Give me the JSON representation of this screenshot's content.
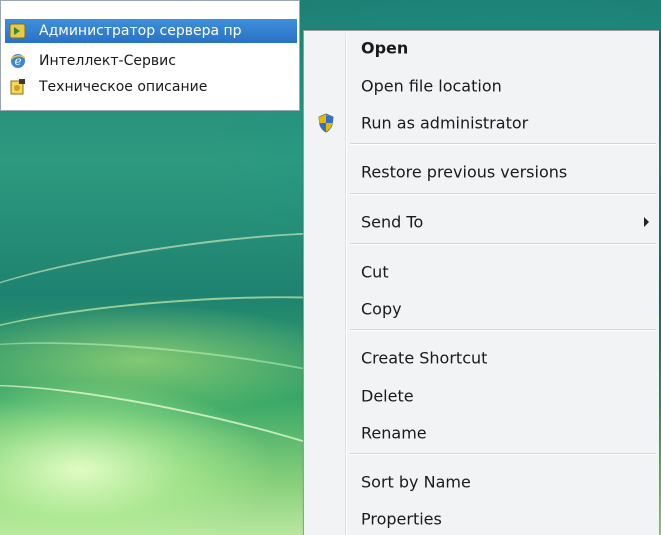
{
  "programs": [
    {
      "label": "Администратор сервера пр",
      "icon": "server-admin-icon",
      "selected": true
    },
    {
      "label": "Интеллект-Сервис",
      "icon": "ie-icon",
      "selected": false
    },
    {
      "label": "Техническое описание",
      "icon": "document-help-icon",
      "selected": false
    }
  ],
  "context_menu": {
    "items": {
      "open": "Open",
      "open_file_location": "Open file location",
      "run_as_admin": "Run as administrator",
      "restore_previous": "Restore previous versions",
      "send_to": "Send To",
      "cut": "Cut",
      "copy": "Copy",
      "create_shortcut": "Create Shortcut",
      "delete": "Delete",
      "rename": "Rename",
      "sort_by_name": "Sort by Name",
      "properties": "Properties"
    }
  },
  "colors": {
    "selection": "#2a72c4",
    "menu_bg": "#f2f3f5",
    "desktop": "#1e7f75"
  }
}
